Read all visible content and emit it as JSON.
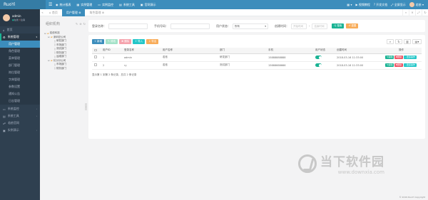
{
  "app": {
    "logo": "RuoYi"
  },
  "topnav": [
    {
      "label": "统计报表",
      "icon": "chart-icon"
    },
    {
      "label": "实例管理",
      "icon": "grid-icon"
    },
    {
      "label": "实例监控",
      "icon": "monitor-icon"
    },
    {
      "label": "系统工具",
      "icon": "tools-icon"
    },
    {
      "label": "官网演示",
      "icon": "screen-icon"
    }
  ],
  "topright": {
    "layout_icon": "▦ ▾",
    "video": "视频教程",
    "docs": "开发文档",
    "fullscreen": "全屏显示",
    "user": "若依 ▾"
  },
  "user": {
    "name": "admin",
    "online": "在线",
    "logout": "注销"
  },
  "sidebar": {
    "items": [
      {
        "label": "首页",
        "icon": "home-icon"
      },
      {
        "label": "系统管理",
        "icon": "gear-icon",
        "open": true
      }
    ],
    "sub": [
      "用户管理",
      "角色管理",
      "菜单管理",
      "部门管理",
      "岗位管理",
      "字典管理",
      "参数设置",
      "通知公告",
      "日志管理"
    ],
    "items_after": [
      {
        "label": "系统监控",
        "icon": "monitor-icon"
      },
      {
        "label": "系统工具",
        "icon": "tools-icon"
      },
      {
        "label": "若依官网",
        "icon": "link-icon"
      },
      {
        "label": "实例演示",
        "icon": "screen-icon"
      }
    ]
  },
  "tabs": {
    "home": "首页",
    "user": "用户管理 ⊗",
    "role": "角色管理 ⊗"
  },
  "tree": {
    "title": "组织机构",
    "nodes": [
      {
        "label": "若依科技",
        "level": 0,
        "type": "folder"
      },
      {
        "label": "深圳总公司",
        "level": 1,
        "type": "folder"
      },
      {
        "label": "研发部门",
        "level": 2,
        "type": "file"
      },
      {
        "label": "市场部门",
        "level": 2,
        "type": "file"
      },
      {
        "label": "测试部门",
        "level": 2,
        "type": "file"
      },
      {
        "label": "财务部门",
        "level": 2,
        "type": "file"
      },
      {
        "label": "运维部门",
        "level": 2,
        "type": "file"
      },
      {
        "label": "长沙分公司",
        "level": 1,
        "type": "folder"
      },
      {
        "label": "市场部门",
        "level": 2,
        "type": "file"
      },
      {
        "label": "财务部门",
        "level": 2,
        "type": "file"
      }
    ]
  },
  "search": {
    "login_label": "登录名称：",
    "phone_label": "手机号码：",
    "status_label": "用户状态：",
    "status_value": "所有",
    "time_label": "创建时间：",
    "start_placeholder": "开始时间",
    "end_placeholder": "结束时间",
    "dash": "-",
    "search_btn": "Q 搜索",
    "reset_btn": "↺ 重置"
  },
  "toolbar": {
    "add": "+ 新增",
    "edit": "✎ 修改",
    "delete": "✖ 删除",
    "import": "⇪ 导入",
    "export": "⇩ 导出"
  },
  "toolright": {
    "search": "⌕",
    "refresh": "↻",
    "columns": "▥",
    "more": "▤▾"
  },
  "table": {
    "headers": [
      "用户ID",
      "登录名称",
      "用户名称",
      "部门",
      "手机",
      "用户状态",
      "创建时间",
      "操作"
    ],
    "rows": [
      {
        "id": "1",
        "login": "admin",
        "name": "若依",
        "dept": "研发部门",
        "phone": "15888888888",
        "status": "on",
        "created": "2018-03-16 11:33:00"
      },
      {
        "id": "2",
        "login": "ry",
        "name": "若依",
        "dept": "测试部门",
        "phone": "15666666666",
        "status": "on",
        "created": "2018-03-16 11:33:00"
      }
    ],
    "ops": [
      "✎编辑",
      "✖删除",
      "⋯更多操作"
    ]
  },
  "pager": "显示第 1 到第 2 条记录，总共 2 条记录",
  "footer": "© 2019 RuoYi Copyright",
  "watermark": {
    "cn": "当下软件园",
    "url": "www.downxia.com"
  },
  "colors": {
    "primary": "#3c8dbc",
    "sidebar": "#2f4050",
    "success": "#1ab394",
    "danger": "#ed5565",
    "warning": "#f8ac59",
    "info": "#23c6c8"
  }
}
